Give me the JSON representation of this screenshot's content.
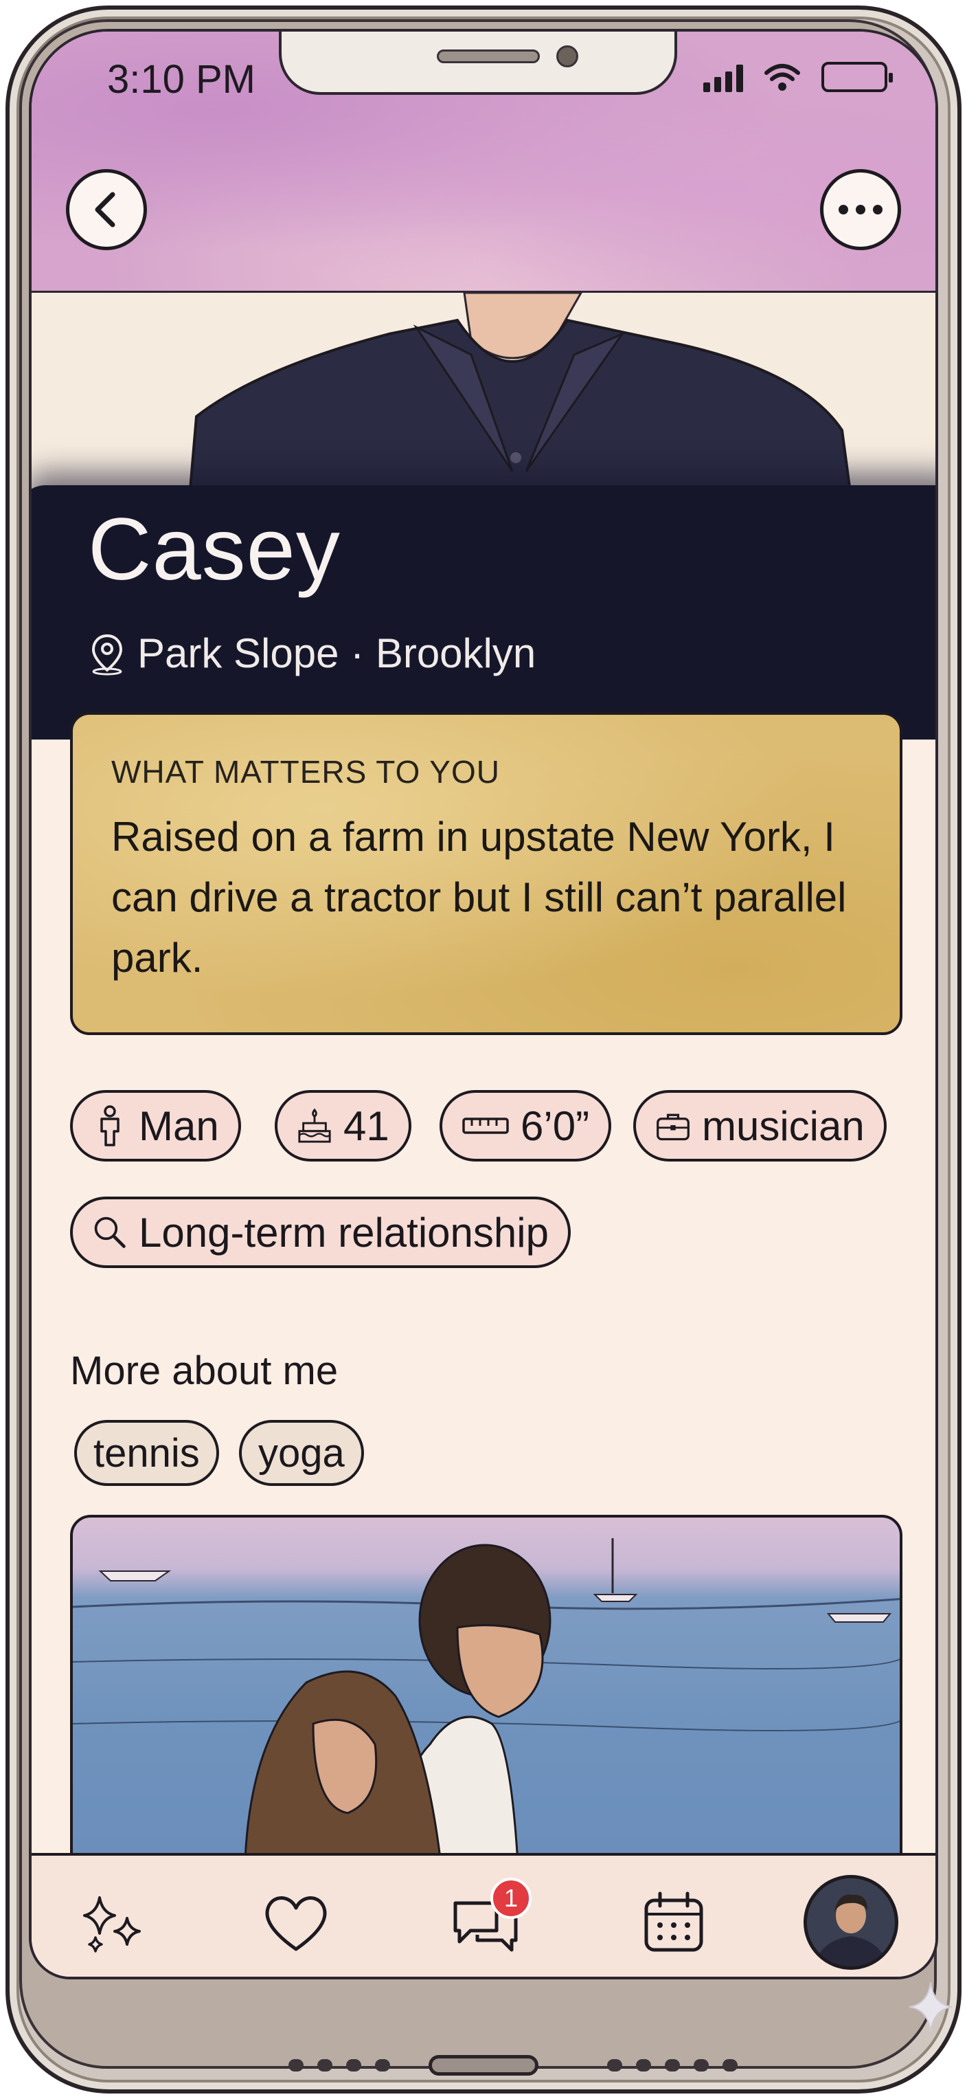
{
  "status_bar": {
    "time": "3:10 PM"
  },
  "profile": {
    "name": "Casey",
    "location": "Park Slope · Brooklyn"
  },
  "prompt": {
    "title": "WHAT MATTERS TO YOU",
    "answer": "Raised on a farm in upstate New York, I can drive a tractor but I still can’t parallel park."
  },
  "chips": [
    {
      "icon": "person-icon",
      "label": "Man"
    },
    {
      "icon": "cake-icon",
      "label": "41"
    },
    {
      "icon": "ruler-icon",
      "label": "6’0”"
    },
    {
      "icon": "briefcase-icon",
      "label": "musician"
    },
    {
      "icon": "search-icon",
      "label": "Long-term relationship"
    }
  ],
  "more_about": {
    "title": "More about me",
    "tags": [
      "tennis",
      "yoga"
    ]
  },
  "nav": {
    "items": [
      "sparkles-icon",
      "heart-icon",
      "chat-icon",
      "calendar-icon",
      "avatar"
    ],
    "chat_badge": "1"
  },
  "colors": {
    "top_band": "#d6a4cc",
    "hero_wash": "#16162b",
    "prompt_card": "#dcbb72",
    "chip_bg": "#f6dcd5",
    "badge": "#e23b42"
  }
}
